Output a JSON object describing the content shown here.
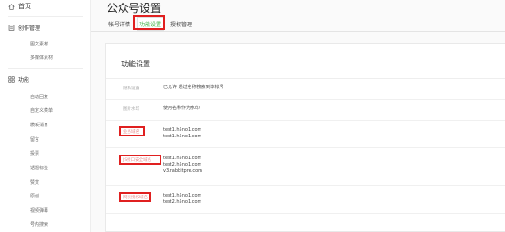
{
  "sidebar": {
    "home": "首页",
    "sections": [
      {
        "label": "创作管理",
        "icon": "document-icon",
        "items": [
          "图文素材",
          "多媒体素材"
        ]
      },
      {
        "label": "功能",
        "icon": "grid-icon",
        "items": [
          "自动回复",
          "自定义菜单",
          "模板消息",
          "留言",
          "投票",
          "话题标签",
          "赞赏",
          "原创",
          "视频弹幕",
          "号内搜索"
        ]
      }
    ]
  },
  "main": {
    "title": "公众号设置",
    "tabs": [
      "帐号详情",
      "功能设置",
      "授权管理"
    ],
    "active_tab": "功能设置",
    "panel": {
      "title": "功能设置",
      "rows": [
        {
          "label": "隐私设置",
          "values": [
            "已允许 通过名称搜索到本帐号"
          ]
        },
        {
          "label": "图片水印",
          "values": [
            "使用名称作为水印"
          ]
        },
        {
          "label": "业务域名",
          "values": [
            "test1.h5no1.com",
            "test1.h5no1.com"
          ]
        },
        {
          "label": "JS接口安全域名",
          "values": [
            "test1.h5no1.com",
            "test2.h5no1.com",
            "v3.rabbitpre.com"
          ]
        },
        {
          "label": "网页授权域名",
          "values": [
            "test1.h5no1.com",
            "test2.h5no1.com"
          ]
        }
      ]
    }
  },
  "colors": {
    "accent": "#44b549",
    "highlight": "#e02020"
  }
}
